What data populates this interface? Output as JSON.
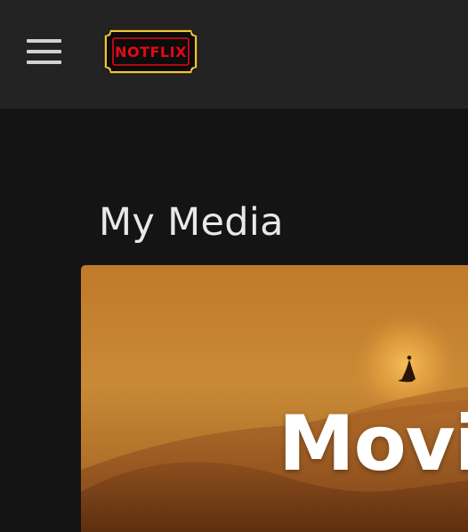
{
  "header": {
    "menu_icon": "hamburger-menu-icon",
    "logo_text": "NOTFLIX",
    "logo_color": "#e50914"
  },
  "main": {
    "title": "My Media",
    "cards": [
      {
        "label": "Movie"
      }
    ]
  },
  "colors": {
    "background": "#141414",
    "topbar": "#232323",
    "accent": "#e50914",
    "title_text": "#e8e8e8"
  }
}
